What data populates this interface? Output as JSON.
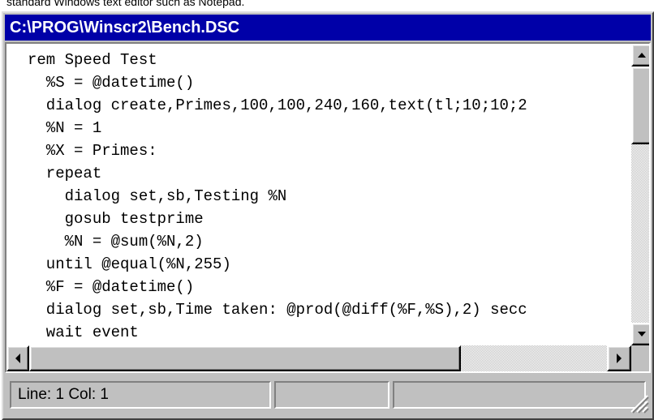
{
  "caption": "standard Windows text editor such as Notepad.",
  "window": {
    "title": "C:\\PROG\\Winscr2\\Bench.DSC"
  },
  "editor": {
    "lines": [
      "rem Speed Test",
      "  %S = @datetime()",
      "  dialog create,Primes,100,100,240,160,text(tl;10;10;2",
      "  %N = 1",
      "  %X = Primes:",
      "  repeat",
      "    dialog set,sb,Testing %N",
      "    gosub testprime",
      "    %N = @sum(%N,2)",
      "  until @equal(%N,255)",
      "  %F = @datetime()",
      "  dialog set,sb,Time taken: @prod(@diff(%F,%S),2) secc",
      "  wait event"
    ]
  },
  "scrollbars": {
    "up_icon": "arrow-up-icon",
    "down_icon": "arrow-down-icon",
    "left_icon": "arrow-left-icon",
    "right_icon": "arrow-right-icon"
  },
  "statusbar": {
    "position": "Line: 1  Col: 1",
    "panel2": "",
    "panel3": ""
  },
  "colors": {
    "titlebar": "#0000a8",
    "face": "#c0c0c0"
  }
}
